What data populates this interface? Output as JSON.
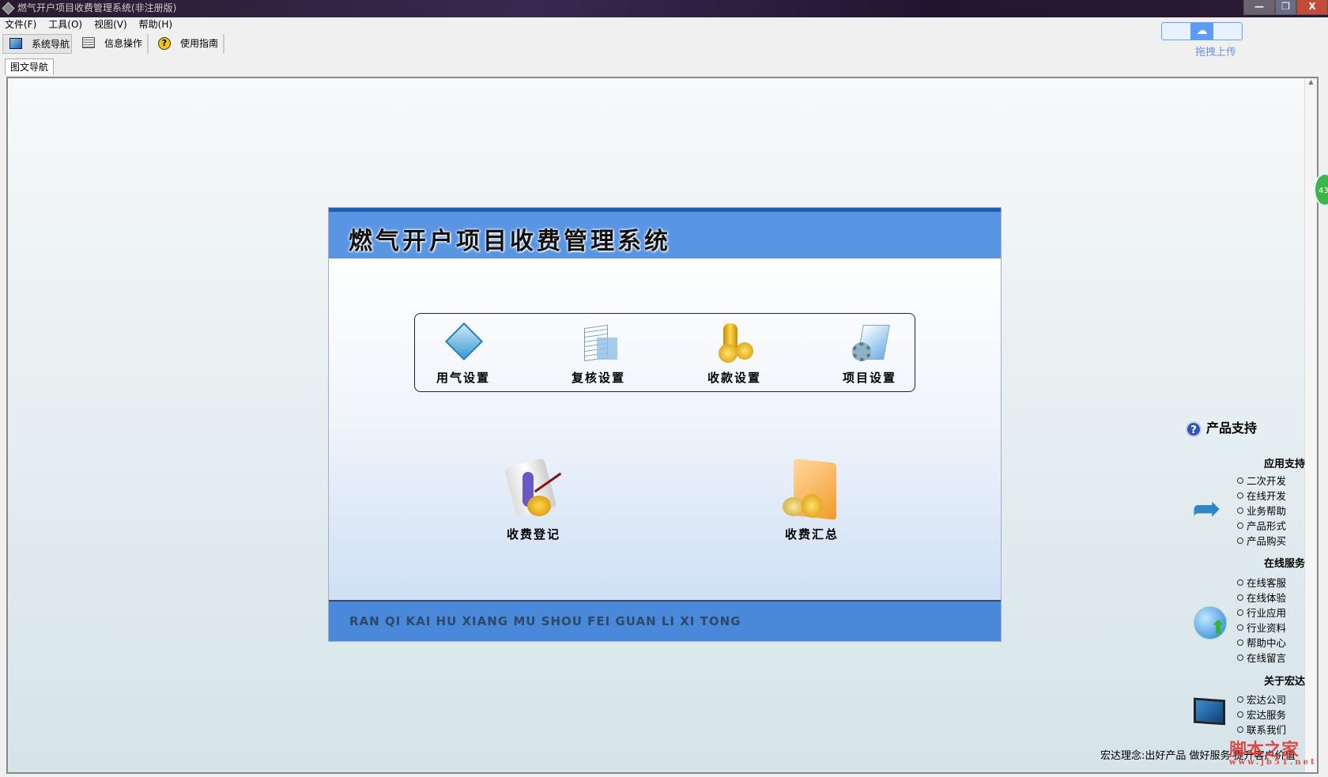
{
  "window": {
    "title": "燃气开户项目收费管理系统(非注册版)",
    "controls": {
      "minimize": "—",
      "restore": "❐",
      "close": "X"
    }
  },
  "menu": [
    "文件(F)",
    "工具(O)",
    "视图(V)",
    "帮助(H)"
  ],
  "toolbar": [
    {
      "label": "系统导航",
      "icon": "monitor-icon",
      "active": true
    },
    {
      "label": "信息操作",
      "icon": "grid-icon"
    },
    {
      "label": "使用指南",
      "icon": "help-icon"
    }
  ],
  "upload": {
    "label": "拖拽上传",
    "icon": "cloud-icon"
  },
  "tab": "图文导航",
  "panel": {
    "title": "燃气开户项目收费管理系统",
    "settings": [
      {
        "label": "用气设置",
        "icon": "diamond-book-icon"
      },
      {
        "label": "复核设置",
        "icon": "clipboard-icon"
      },
      {
        "label": "收款设置",
        "icon": "coins-icon"
      },
      {
        "label": "项目设置",
        "icon": "folder-gear-icon"
      }
    ],
    "actions": [
      {
        "label": "收费登记",
        "icon": "register-icon"
      },
      {
        "label": "收费汇总",
        "icon": "folder-coins-icon"
      }
    ],
    "footer": "RAN QI KAI HU XIANG MU SHOU FEI GUAN LI XI TONG"
  },
  "sidebar": {
    "title": "产品支持",
    "sections": [
      {
        "title": "应用支持",
        "icon": "arrow-icon",
        "items": [
          "二次开发",
          "在线开发",
          "业务帮助",
          "产品形式",
          "产品购买"
        ]
      },
      {
        "title": "在线服务",
        "icon": "globe-icon",
        "items": [
          "在线客服",
          "在线体验",
          "行业应用",
          "行业资料",
          "帮助中心",
          "在线留言"
        ]
      },
      {
        "title": "关于宏达",
        "icon": "monitor-icon",
        "items": [
          "宏达公司",
          "宏达服务",
          "联系我们"
        ]
      }
    ],
    "motto": "宏达理念:出好产品  做好服务  提升客户价值"
  },
  "badge": "43",
  "watermark": {
    "text": "脚本之家",
    "url": "www.jb51.net"
  }
}
